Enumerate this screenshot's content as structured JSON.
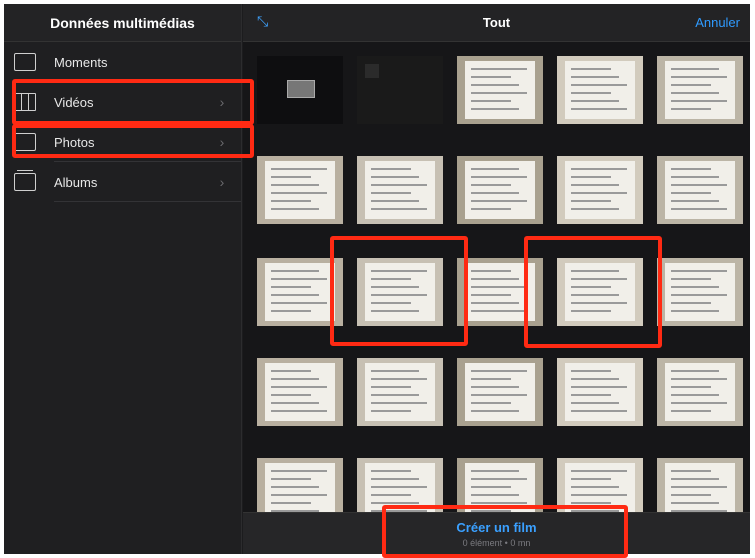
{
  "sidebar": {
    "title": "Données multimédias",
    "items": [
      {
        "label": "Moments",
        "chevron": ""
      },
      {
        "label": "Vidéos",
        "chevron": "›"
      },
      {
        "label": "Photos",
        "chevron": "›"
      },
      {
        "label": "Albums",
        "chevron": "›"
      }
    ]
  },
  "topbar": {
    "title": "Tout",
    "cancel_label": "Annuler",
    "expand_icon": "⤡"
  },
  "bottombar": {
    "create_label": "Créer un film",
    "subtitle": "0 élément • 0 mn"
  },
  "colors": {
    "accent": "#2f9bff",
    "highlight": "#ff2a13"
  }
}
